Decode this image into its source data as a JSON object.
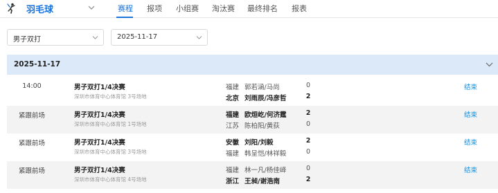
{
  "header": {
    "sport": "羽毛球",
    "tabs": [
      {
        "label": "赛程",
        "active": true
      },
      {
        "label": "报项",
        "active": false
      },
      {
        "label": "小组赛",
        "active": false
      },
      {
        "label": "淘汰赛",
        "active": false
      },
      {
        "label": "最终排名",
        "active": false
      },
      {
        "label": "报表",
        "active": false
      }
    ]
  },
  "filters": {
    "event": "男子双打",
    "date": "2025-11-17"
  },
  "schedule": {
    "date": "2025-11-17",
    "matches": [
      {
        "time": "14:00",
        "name": "男子双打1/4决赛",
        "venue": "深圳市体育中心体育馆 3号场地",
        "team1": {
          "province": "福建",
          "players": "郭若涵/马尚",
          "score": "0"
        },
        "team2": {
          "province": "北京",
          "players": "刘雨辰/冯彦哲",
          "score": "2"
        },
        "status": "结束"
      },
      {
        "time": "紧跟前场",
        "name": "男子双打1/4决赛",
        "venue": "深圳市体育中心体育馆 1号场地",
        "team1": {
          "province": "福建",
          "players": "欧烜屹/何济霆",
          "score": "2"
        },
        "team2": {
          "province": "江苏",
          "players": "陈柏阳/黄荻",
          "score": "0"
        },
        "status": "结束"
      },
      {
        "time": "紧跟前场",
        "name": "男子双打1/4决赛",
        "venue": "深圳市体育中心体育馆 3号场地",
        "team1": {
          "province": "安徽",
          "players": "刘阳/刘毅",
          "score": "2"
        },
        "team2": {
          "province": "福建",
          "players": "韩呈恺/林祥毅",
          "score": "0"
        },
        "status": "结束"
      },
      {
        "time": "紧跟前场",
        "name": "男子双打1/4决赛",
        "venue": "深圳市体育中心体育馆 4号场地",
        "team1": {
          "province": "福建",
          "players": "林一凡/杨佳峄",
          "score": "0"
        },
        "team2": {
          "province": "浙江",
          "players": "王昶/谢浩南",
          "score": "2"
        },
        "status": "结束"
      }
    ]
  }
}
